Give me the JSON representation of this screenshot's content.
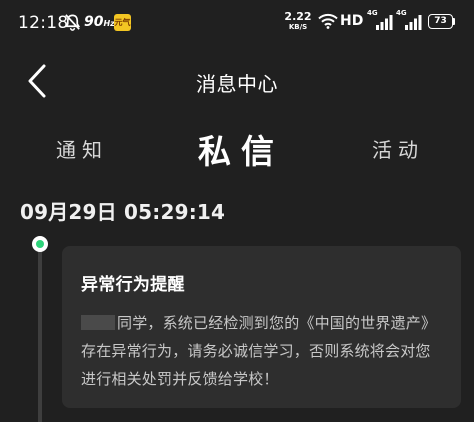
{
  "status_bar": {
    "time": "12:18",
    "refresh_rate": "90",
    "refresh_unit": "Hz",
    "app_icon_text": "元气",
    "net_speed_value": "2.22",
    "net_speed_unit": "KB/S",
    "hd_label": "HD",
    "network_1": "4G",
    "network_2": "4G",
    "battery_level": "73",
    "icons": [
      "mute-icon",
      "app-icon",
      "wifi-icon",
      "signal-icon",
      "signal-icon",
      "battery-icon"
    ]
  },
  "nav": {
    "title": "消息中心",
    "back_icon": "chevron-left-icon"
  },
  "tabs": {
    "notice": "通知",
    "private_message": "私信",
    "activity": "活动",
    "active": "private_message"
  },
  "message": {
    "time": "09月29日 05:29:14",
    "title": "异常行为提醒",
    "body": "同学，系统已经检测到您的《中国的世界遗产》存在异常行为，请务必诚信学习，否则系统将会对您进行相关处罚并反馈给学校！",
    "status_color": "#2ed37a"
  },
  "colors": {
    "background": "#202020",
    "card": "#2e2e2e",
    "accent": "#2ed37a"
  }
}
